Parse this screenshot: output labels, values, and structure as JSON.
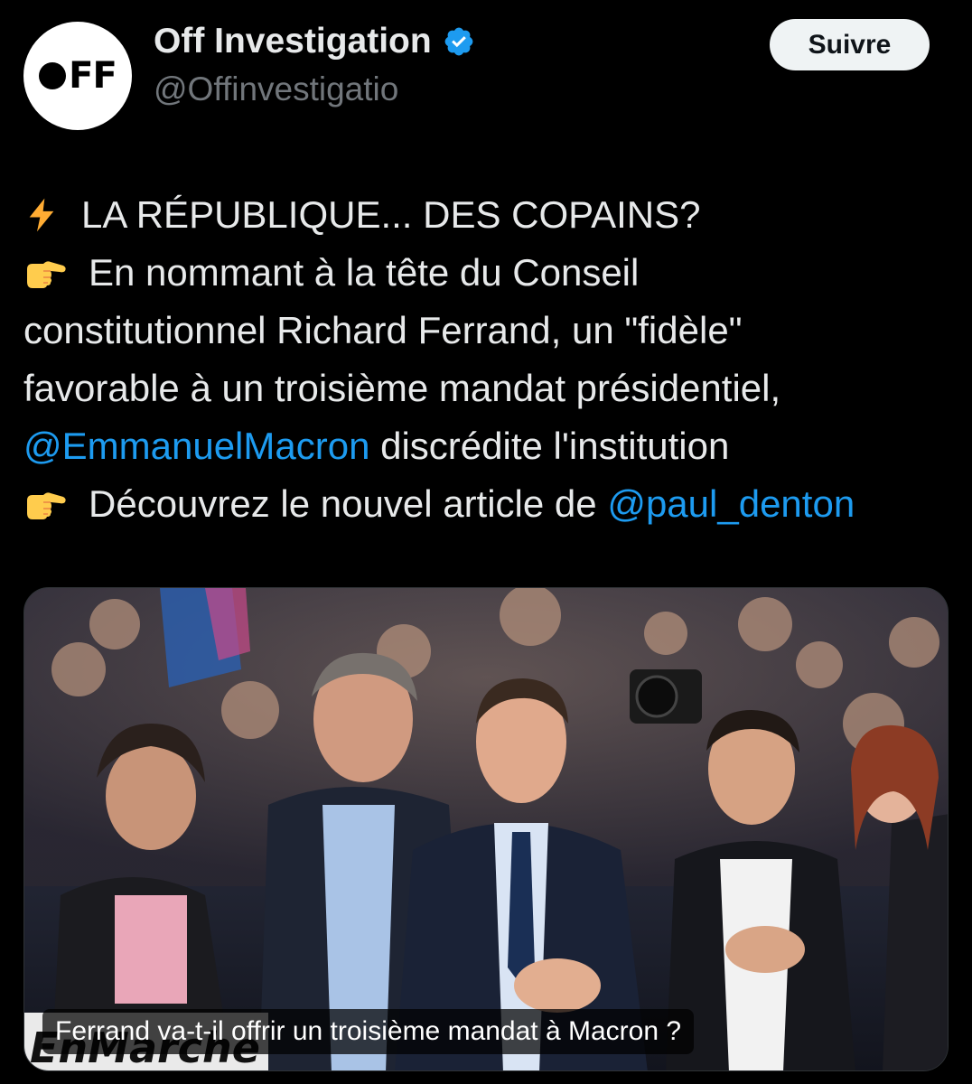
{
  "author": {
    "display_name": "Off Investigation",
    "handle": "@Offinvestigatio",
    "avatar_text": "FF",
    "verified": true
  },
  "follow_button": {
    "label": "Suivre"
  },
  "tweet": {
    "line1_text": "LA RÉPUBLIQUE... DES COPAINS?",
    "line2_text": "En nommant à la tête du Conseil",
    "line3_text": "constitutionnel Richard Ferrand, un \"fidèle\"",
    "line4_text": "favorable à un troisième mandat présidentiel,",
    "line5_mention": "@EmmanuelMacron",
    "line5_text": " discrédite l'institution",
    "line6_text": "Découvrez le nouvel article de ",
    "line6_mention": "@paul_denton",
    "emoji_1": "lightning-emoji",
    "emoji_2": "pointing-hand-emoji"
  },
  "card": {
    "caption": "Ferrand va-t-il offrir un troisième mandat à Macron ?",
    "banner_text": "EnMarche"
  },
  "colors": {
    "background": "#000000",
    "text": "#e7e9ea",
    "secondary": "#71767b",
    "link": "#1d9bf0",
    "verified": "#1d9bf0"
  }
}
